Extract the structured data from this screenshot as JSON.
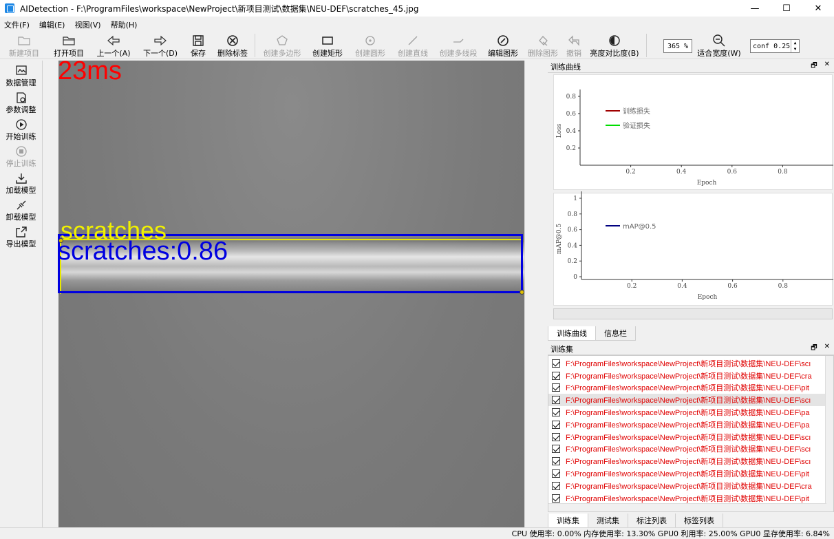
{
  "window": {
    "title": "AIDetection - F:\\ProgramFiles\\workspace\\NewProject\\新项目测试\\数据集\\NEU-DEF\\scratches_45.jpg",
    "minimize": "—",
    "maximize": "☐",
    "close": "✕"
  },
  "menu": [
    "文件(F)",
    "编辑(E)",
    "视图(V)",
    "帮助(H)"
  ],
  "toolbar": {
    "new_project": "新建项目",
    "open_project": "打开项目",
    "prev": "上一个(A)",
    "next": "下一个(D)",
    "save": "保存",
    "delete_label": "删除标签",
    "create_polygon": "创建多边形",
    "create_rect": "创建矩形",
    "create_circle": "创建圆形",
    "create_line": "创建直线",
    "create_polyline": "创建多线段",
    "edit_shape": "编辑图形",
    "delete_shape": "删除图形",
    "undo": "撤销",
    "brightness": "亮度对比度(B)",
    "zoom": "365 %",
    "fit_width": "适合宽度(W)",
    "conf": "conf 0.25"
  },
  "leftbar": [
    "数据管理",
    "参数调整",
    "开始训练",
    "停止训练",
    "加载模型",
    "卸载模型",
    "导出模型"
  ],
  "canvas": {
    "time": "23ms",
    "label_yellow": "scratches",
    "label_blue": "scratches:0.86"
  },
  "train_curve": {
    "title": "训练曲线",
    "loss_chart": {
      "ylabel": "Loss",
      "xlabel": "Epoch",
      "yticks": [
        "0.8",
        "0.6",
        "0.4",
        "0.2"
      ],
      "xticks": [
        "0.2",
        "0.4",
        "0.6",
        "0.8"
      ],
      "legend": [
        {
          "name": "训练损失",
          "color": "#a00000"
        },
        {
          "name": "验证损失",
          "color": "#00dd00"
        }
      ]
    },
    "map_chart": {
      "ylabel": "mAP@0.5",
      "xlabel": "Epoch",
      "yticks": [
        "1",
        "0.8",
        "0.6",
        "0.4",
        "0.2",
        "0"
      ],
      "xticks": [
        "0.2",
        "0.4",
        "0.6",
        "0.8"
      ],
      "legend": [
        {
          "name": "mAP@0.5",
          "color": "#000080"
        }
      ]
    },
    "tabs": [
      "训练曲线",
      "信息栏"
    ]
  },
  "train_set": {
    "title": "训练集",
    "items": [
      "F:\\ProgramFiles\\workspace\\NewProject\\新项目测试\\数据集\\NEU-DEF\\scı",
      "F:\\ProgramFiles\\workspace\\NewProject\\新项目测试\\数据集\\NEU-DEF\\cra",
      "F:\\ProgramFiles\\workspace\\NewProject\\新项目测试\\数据集\\NEU-DEF\\pit",
      "F:\\ProgramFiles\\workspace\\NewProject\\新项目测试\\数据集\\NEU-DEF\\scı",
      "F:\\ProgramFiles\\workspace\\NewProject\\新项目测试\\数据集\\NEU-DEF\\pa",
      "F:\\ProgramFiles\\workspace\\NewProject\\新项目测试\\数据集\\NEU-DEF\\pa",
      "F:\\ProgramFiles\\workspace\\NewProject\\新项目测试\\数据集\\NEU-DEF\\scı",
      "F:\\ProgramFiles\\workspace\\NewProject\\新项目测试\\数据集\\NEU-DEF\\scı",
      "F:\\ProgramFiles\\workspace\\NewProject\\新项目测试\\数据集\\NEU-DEF\\scı",
      "F:\\ProgramFiles\\workspace\\NewProject\\新项目测试\\数据集\\NEU-DEF\\pit",
      "F:\\ProgramFiles\\workspace\\NewProject\\新项目测试\\数据集\\NEU-DEF\\cra",
      "F:\\ProgramFiles\\workspace\\NewProject\\新项目测试\\数据集\\NEU-DEF\\pit"
    ],
    "tabs": [
      "训练集",
      "测试集",
      "标注列表",
      "标签列表"
    ]
  },
  "status": "CPU 使用率: 0.00% 内存使用率: 13.30% GPU0 利用率: 25.00% GPU0 显存使用率: 6.84%"
}
